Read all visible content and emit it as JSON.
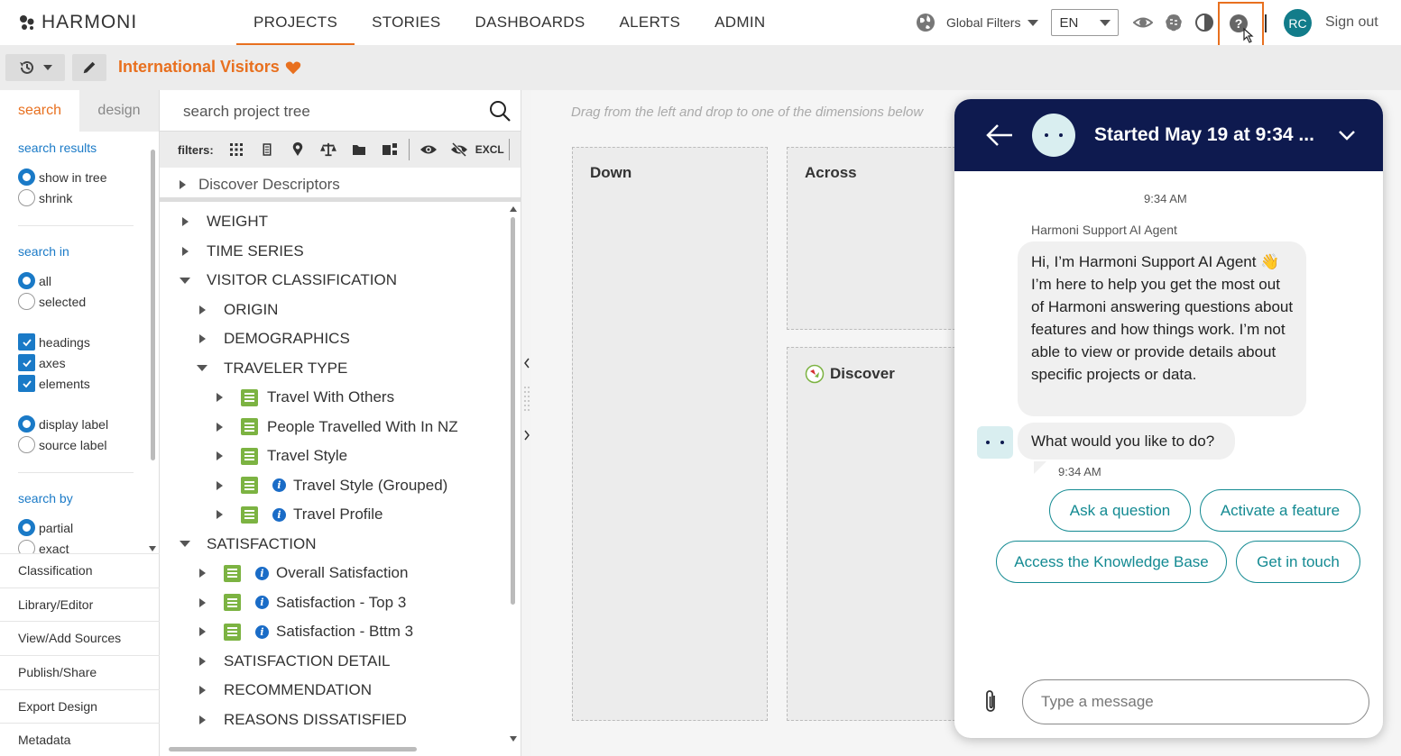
{
  "app": {
    "logo_text": "HARMONI"
  },
  "nav": {
    "items": [
      "PROJECTS",
      "STORIES",
      "DASHBOARDS",
      "ALERTS",
      "ADMIN"
    ],
    "active": "PROJECTS"
  },
  "toolbar": {
    "global_filters": "Global Filters",
    "language": "EN",
    "avatar_initials": "RC",
    "sign_out": "Sign out"
  },
  "project": {
    "title": "International Visitors"
  },
  "left_panel": {
    "tabs": [
      "search",
      "design"
    ],
    "active_tab": "search",
    "search_results": {
      "label": "search results",
      "options": [
        "show in tree",
        "shrink"
      ],
      "selected": "show in tree"
    },
    "search_in": {
      "label": "search in",
      "options": [
        "all",
        "selected"
      ],
      "selected": "all"
    },
    "checkboxes": [
      "headings",
      "axes",
      "elements"
    ],
    "label_mode": {
      "options": [
        "display label",
        "source label"
      ],
      "selected": "display label"
    },
    "search_by": {
      "label": "search by",
      "options": [
        "partial",
        "exact"
      ],
      "selected": "partial"
    },
    "menu": [
      "Classification",
      "Library/Editor",
      "View/Add Sources",
      "Publish/Share",
      "Export Design",
      "Metadata"
    ]
  },
  "tree_panel": {
    "search_placeholder": "search project tree",
    "filters_label": "filters:",
    "excl_label": "EXCL",
    "descriptors_row": "Discover Descriptors",
    "rows": [
      {
        "label": "WEIGHT",
        "depth": 0,
        "state": "collapsed",
        "doc": false,
        "info": false
      },
      {
        "label": "TIME SERIES",
        "depth": 0,
        "state": "collapsed",
        "doc": false,
        "info": false
      },
      {
        "label": "VISITOR CLASSIFICATION",
        "depth": 0,
        "state": "expanded",
        "doc": false,
        "info": false
      },
      {
        "label": "ORIGIN",
        "depth": 1,
        "state": "collapsed",
        "doc": false,
        "info": false
      },
      {
        "label": "DEMOGRAPHICS",
        "depth": 1,
        "state": "collapsed",
        "doc": false,
        "info": false
      },
      {
        "label": "TRAVELER TYPE",
        "depth": 1,
        "state": "expanded",
        "doc": false,
        "info": false
      },
      {
        "label": "Travel With Others",
        "depth": 2,
        "state": "collapsed",
        "doc": true,
        "info": false
      },
      {
        "label": "People Travelled With In NZ",
        "depth": 2,
        "state": "collapsed",
        "doc": true,
        "info": false
      },
      {
        "label": "Travel Style",
        "depth": 2,
        "state": "collapsed",
        "doc": true,
        "info": false
      },
      {
        "label": "Travel Style (Grouped)",
        "depth": 2,
        "state": "collapsed",
        "doc": true,
        "info": true
      },
      {
        "label": "Travel Profile",
        "depth": 2,
        "state": "collapsed",
        "doc": true,
        "info": true
      },
      {
        "label": "SATISFACTION",
        "depth": 0,
        "state": "expanded",
        "doc": false,
        "info": false
      },
      {
        "label": "Overall Satisfaction",
        "depth": 1,
        "state": "collapsed",
        "doc": true,
        "info": true
      },
      {
        "label": "Satisfaction - Top 3",
        "depth": 1,
        "state": "collapsed",
        "doc": true,
        "info": true
      },
      {
        "label": "Satisfaction - Bttm 3",
        "depth": 1,
        "state": "collapsed",
        "doc": true,
        "info": true
      },
      {
        "label": "SATISFACTION DETAIL",
        "depth": 1,
        "state": "collapsed",
        "doc": false,
        "info": false
      },
      {
        "label": "RECOMMENDATION",
        "depth": 1,
        "state": "collapsed",
        "doc": false,
        "info": false
      },
      {
        "label": "REASONS DISSATISFIED",
        "depth": 1,
        "state": "collapsed",
        "doc": false,
        "info": false
      }
    ]
  },
  "canvas": {
    "hint": "Drag from the left and drop to one of the dimensions below",
    "down_label": "Down",
    "across_label": "Across",
    "discover_label": "Discover"
  },
  "chat": {
    "header_title": "Started May 19 at 9:34 ...",
    "time_top": "9:34 AM",
    "sender": "Harmoni Support AI Agent",
    "message_1": "Hi, I’m Harmoni Support AI Agent 👋 I’m here to help you get the most out of Harmoni answering questions about features and how things work. I’m not able to view or provide details about specific projects or data.",
    "message_2": "What would you like to do?",
    "time_bottom": "9:34 AM",
    "quick_replies": [
      "Ask a question",
      "Activate a feature",
      "Access the Knowledge Base",
      "Get in touch"
    ],
    "input_placeholder": "Type a message"
  },
  "colors": {
    "accent": "#e8701f",
    "link": "#1a7ac7",
    "chat_header": "#0e1a4f",
    "chat_teal": "#138a92",
    "doc_green": "#7cb342"
  }
}
